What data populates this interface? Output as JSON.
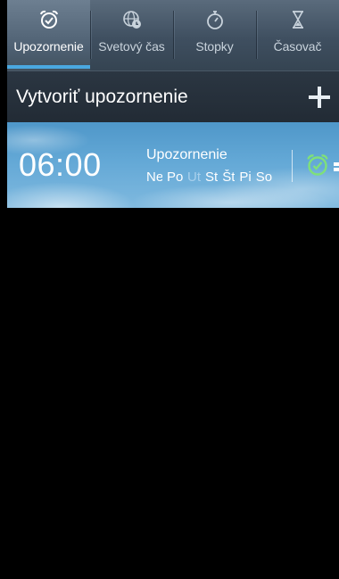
{
  "tabs": [
    {
      "label": "Upozornenie",
      "icon": "alarm-clock-icon",
      "active": true
    },
    {
      "label": "Svetový čas",
      "icon": "globe-icon",
      "active": false
    },
    {
      "label": "Stopky",
      "icon": "stopwatch-icon",
      "active": false
    },
    {
      "label": "Časovač",
      "icon": "hourglass-icon",
      "active": false
    }
  ],
  "create": {
    "label": "Vytvoriť upozornenie",
    "icon": "plus-icon"
  },
  "alarms": [
    {
      "time": "06:00",
      "name": "Upozornenie",
      "days": [
        {
          "label": "Ne",
          "active": true
        },
        {
          "label": "Po",
          "active": true
        },
        {
          "label": "Ut",
          "active": false
        },
        {
          "label": "St",
          "active": true
        },
        {
          "label": "Št",
          "active": true
        },
        {
          "label": "Pi",
          "active": true
        },
        {
          "label": "So",
          "active": true
        }
      ],
      "enabled": true,
      "toggle_icon": "alarm-clock-icon"
    }
  ],
  "colors": {
    "accent": "#4aa8e0",
    "alarm_on": "#7fe07a",
    "tab_text": "#c9d3dc"
  }
}
